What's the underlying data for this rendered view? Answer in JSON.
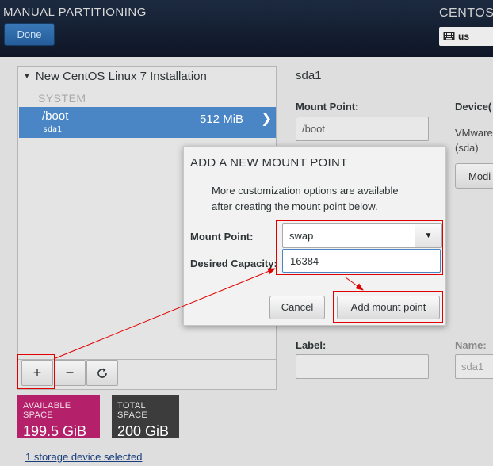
{
  "header": {
    "title": "MANUAL PARTITIONING",
    "done_label": "Done",
    "product": "CENTOS L",
    "keyboard_layout": "us"
  },
  "left_panel": {
    "install_title": "New CentOS Linux 7 Installation",
    "system_label": "SYSTEM",
    "partition": {
      "mount_point": "/boot",
      "device": "sda1",
      "size": "512 MiB"
    },
    "toolbar": {
      "add": "+",
      "remove": "−",
      "refresh": "⟳"
    }
  },
  "space": {
    "available_label": "AVAILABLE SPACE",
    "available_value": "199.5 GiB",
    "available_color": "#b5206b",
    "total_label": "TOTAL SPACE",
    "total_value": "200 GiB",
    "total_color": "#3c3c3c"
  },
  "storage_link": "1 storage device selected",
  "details": {
    "title": "sda1",
    "mount_point_label": "Mount Point:",
    "mount_point_value": "/boot",
    "device_label": "Device(",
    "device_line1": "VMware",
    "device_line2": "(sda)",
    "modify_label": "Modi",
    "label_label": "Label:",
    "name_label": "Name:",
    "name_value": "sda1"
  },
  "dialog": {
    "title": "ADD A NEW MOUNT POINT",
    "description_line1": "More customization options are available",
    "description_line2": "after creating the mount point below.",
    "mount_point_label": "Mount Point:",
    "mount_point_value": "swap",
    "capacity_label": "Desired Capacity:",
    "capacity_value": "16384",
    "cancel_label": "Cancel",
    "add_label": "Add mount point"
  },
  "annotation_color": "#e00000"
}
